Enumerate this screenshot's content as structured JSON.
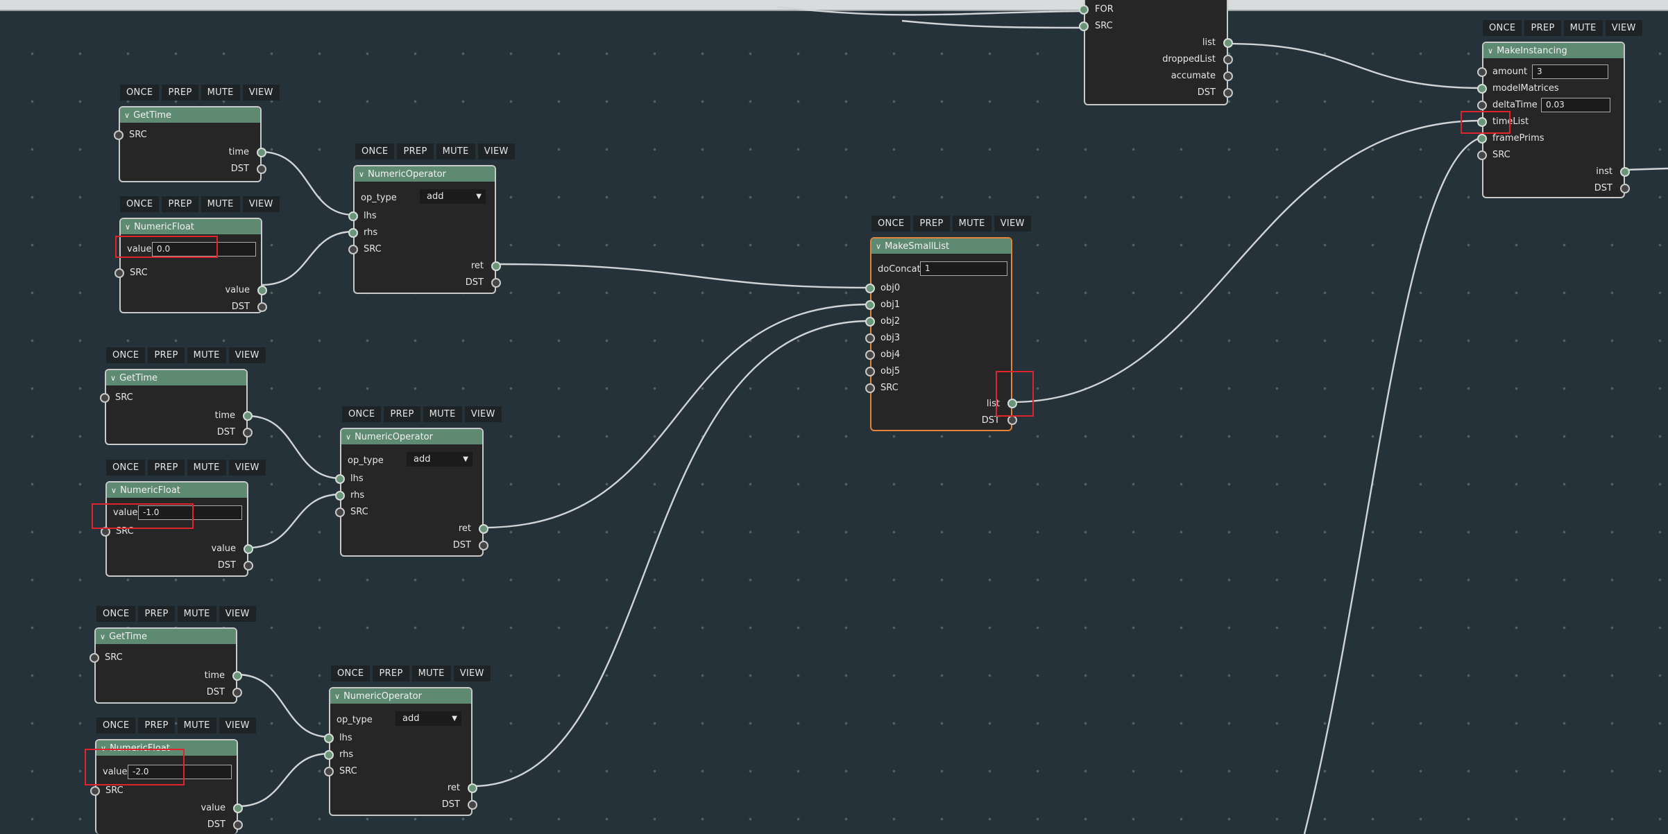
{
  "toolbar_buttons": [
    "ONCE",
    "PREP",
    "MUTE",
    "VIEW"
  ],
  "port_labels": {
    "src": "SRC",
    "dst": "DST",
    "time": "time",
    "value": "value",
    "lhs": "lhs",
    "rhs": "rhs",
    "ret": "ret",
    "op_type": "op_type",
    "list": "list",
    "inst": "inst",
    "for": "FOR",
    "droppedList": "droppedList",
    "accumate": "accumate",
    "doConcat": "doConcat",
    "obj0": "obj0",
    "obj1": "obj1",
    "obj2": "obj2",
    "obj3": "obj3",
    "obj4": "obj4",
    "obj5": "obj5",
    "amount": "amount",
    "modelMatrices": "modelMatrices",
    "deltaTime": "deltaTime",
    "timeList": "timeList",
    "framePrims": "framePrims"
  },
  "nodes": {
    "gettime_1": {
      "title": "GetTime"
    },
    "numericfloat_1": {
      "title": "NumericFloat",
      "value": "0.0"
    },
    "numericop_1": {
      "title": "NumericOperator",
      "op_type": "add"
    },
    "gettime_2": {
      "title": "GetTime"
    },
    "numericfloat_2": {
      "title": "NumericFloat",
      "value": "-1.0"
    },
    "numericop_2": {
      "title": "NumericOperator",
      "op_type": "add"
    },
    "gettime_3": {
      "title": "GetTime"
    },
    "numericfloat_3": {
      "title": "NumericFloat",
      "value": "-2.0"
    },
    "numericop_3": {
      "title": "NumericOperator",
      "op_type": "add"
    },
    "makesmalllist": {
      "title": "MakeSmallList",
      "doConcat": "1"
    },
    "makeinstancing": {
      "title": "MakeInstancing",
      "amount": "3",
      "deltaTime": "0.03"
    }
  },
  "colors": {
    "background": "#263239",
    "node_header": "#5f8a72",
    "node_body": "#262626",
    "selected_border": "#e4843a",
    "highlight": "#e0242d",
    "wire": "#d0d4d6"
  }
}
